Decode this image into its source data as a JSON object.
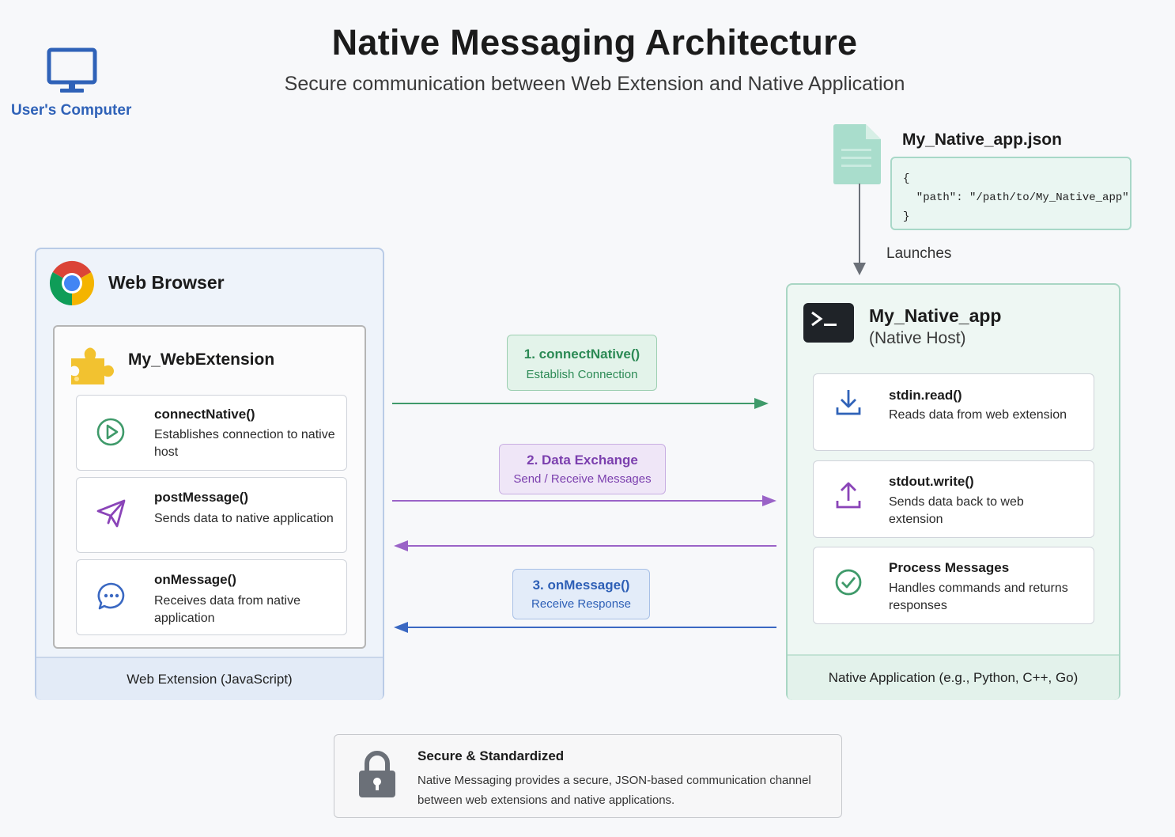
{
  "header": {
    "title": "Native Messaging Architecture",
    "subtitle": "Secure communication between Web Extension and Native Application"
  },
  "computer": {
    "label": "User's Computer",
    "icon": "monitor-icon"
  },
  "manifest": {
    "title": "My_Native_app.json",
    "content": "{\n  \"path\": \"/path/to/My_Native_app\"\n}",
    "icon": "document-icon"
  },
  "launches_label": "Launches",
  "browser": {
    "title": "Web Browser",
    "footer": "Web Extension (JavaScript)",
    "extension": {
      "title": "My_WebExtension",
      "cards": [
        {
          "name": "connectNative()",
          "desc": "Establishes connection to native host",
          "icon": "play-circle-icon"
        },
        {
          "name": "postMessage()",
          "desc": "Sends data to native application",
          "icon": "send-icon"
        },
        {
          "name": "onMessage()",
          "desc": "Receives data from native application",
          "icon": "chat-icon"
        }
      ]
    }
  },
  "native": {
    "title": "My_Native_app",
    "subtitle": "(Native Host)",
    "footer": "Native Application (e.g., Python, C++, Go)",
    "cards": [
      {
        "name": "stdin.read()",
        "desc": "Reads data from web extension",
        "icon": "download-icon"
      },
      {
        "name": "stdout.write()",
        "desc": "Sends data back to web extension",
        "icon": "upload-icon"
      },
      {
        "name": "Process Messages",
        "desc": "Handles commands and returns responses",
        "icon": "check-circle-icon"
      }
    ]
  },
  "steps": [
    {
      "title": "1. connectNative()",
      "desc": "Establish Connection"
    },
    {
      "title": "2. Data Exchange",
      "desc": "Send / Receive Messages"
    },
    {
      "title": "3. onMessage()",
      "desc": "Receive Response"
    }
  ],
  "security": {
    "title": "Secure & Standardized",
    "desc": "Native Messaging provides a secure, JSON-based communication channel between web extensions and native applications."
  },
  "colors": {
    "green": "#3f9a6a",
    "purple": "#9a63c7",
    "blue": "#3a68c2",
    "gray": "#6b7078"
  }
}
